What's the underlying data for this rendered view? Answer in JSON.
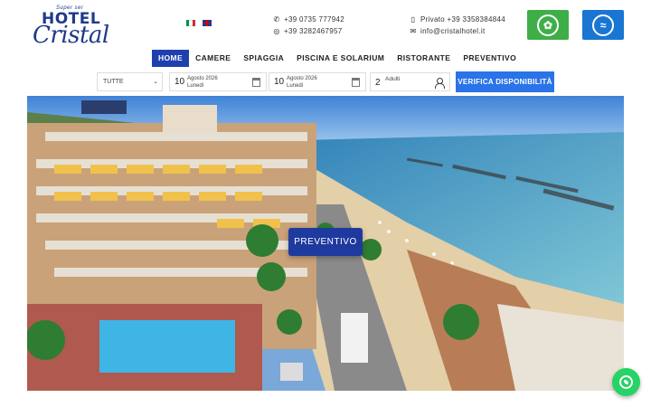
{
  "brand": {
    "super": "Super ser",
    "hotel": "HOTEL",
    "name": "Cristal"
  },
  "contacts": {
    "phone": "+39 0735 777942",
    "whatsapp": "+39 3282467957",
    "mobile": "Privato +39 3358384844",
    "email": "info@cristalhotel.it"
  },
  "nav": [
    {
      "label": "HOME",
      "active": true
    },
    {
      "label": "CAMERE"
    },
    {
      "label": "SPIAGGIA"
    },
    {
      "label": "PISCINA E SOLARIUM"
    },
    {
      "label": "RISTORANTE"
    },
    {
      "label": "PREVENTIVO"
    }
  ],
  "booking": {
    "type_select": "TUTTE",
    "checkin": {
      "day": "10",
      "month": "Agosto 2026",
      "weekday": "Lunedì"
    },
    "checkout": {
      "day": "10",
      "month": "Agosto 2026",
      "weekday": "Lunedì"
    },
    "adults": {
      "count": "2",
      "label": "Adulti"
    },
    "submit": "VERIFICA DISPONIBILITÀ"
  },
  "hero": {
    "cta": "PREVENTIVO"
  },
  "colors": {
    "primary": "#1e40af",
    "button": "#2a73e8",
    "whatsapp": "#25d366",
    "green_badge": "#3fae49",
    "blue_badge": "#1976d2"
  },
  "icons": [
    "phone-icon",
    "whatsapp-icon",
    "mobile-icon",
    "mail-icon",
    "calendar-icon",
    "person-icon",
    "chevron-down-icon"
  ]
}
